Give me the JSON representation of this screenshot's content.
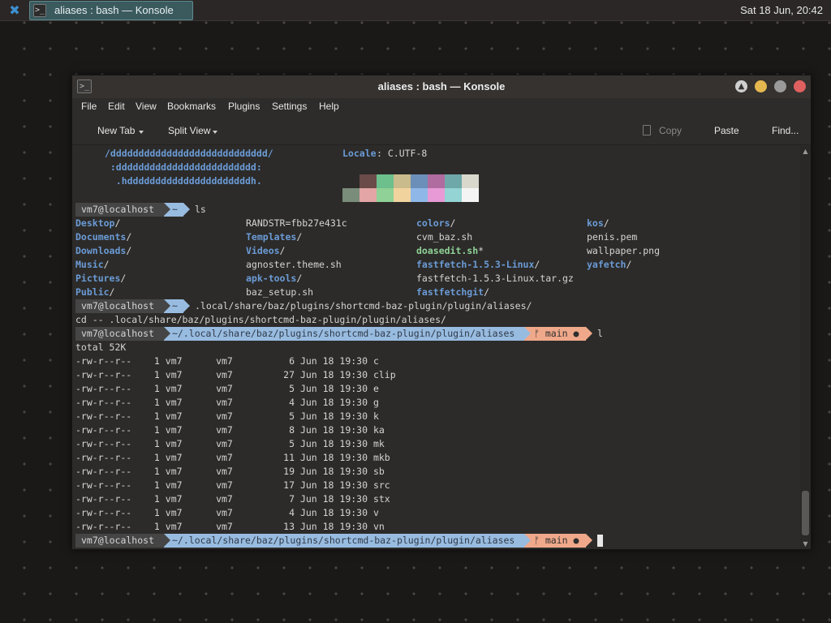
{
  "taskbar": {
    "launcher_icon": "kde-launcher-icon",
    "task_label": "aliases : bash — Konsole",
    "clock": "Sat 18 Jun, 20:42"
  },
  "window": {
    "title": "aliases : bash — Konsole",
    "buttons": [
      "keep-above",
      "minimize",
      "maximize",
      "close"
    ]
  },
  "menu": [
    "File",
    "Edit",
    "View",
    "Bookmarks",
    "Plugins",
    "Settings",
    "Help"
  ],
  "toolbar": {
    "new_tab": "New Tab",
    "split_view": "Split View",
    "copy": "Copy",
    "paste": "Paste",
    "find": "Find..."
  },
  "terminal": {
    "ascii": [
      "/dddddddddddddddddddddddddddd/",
      "  :ddddddddddddddddddddddddd:",
      "   .hddddddddddddddddddddddh."
    ],
    "locale_label": "Locale",
    "locale_value": ": C.UTF-8",
    "palette": {
      "row1": [
        "#2d2b29",
        "#6b4a4a",
        "#6dbf8c",
        "#c9bb8b",
        "#6b8fb8",
        "#b06b9f",
        "#6fa8a8",
        "#d8d8cc"
      ],
      "row2": [
        "#7a8c7a",
        "#e3a5a5",
        "#8fd196",
        "#f1d39e",
        "#8fb8e8",
        "#e79ad6",
        "#94d4d4",
        "#f4f4f4"
      ]
    },
    "prompt_user": "vm7@localhost",
    "prompt_home": "~",
    "prompt_path": "~/.local/share/baz/plugins/shortcmd-baz-plugin/plugin/aliases",
    "git_branch": "ᚠ main ●",
    "cmd_ls": "ls",
    "ls_rows": [
      [
        {
          "t": "Desktop",
          "c": "dir",
          "s": "/"
        },
        {
          "t": "RANDSTR=fbb27e431c",
          "c": "plain",
          "s": ""
        },
        {
          "t": "colors",
          "c": "dir",
          "s": "/"
        },
        {
          "t": "kos",
          "c": "dir",
          "s": "/"
        }
      ],
      [
        {
          "t": "Documents",
          "c": "dir",
          "s": "/"
        },
        {
          "t": "Templates",
          "c": "dir",
          "s": "/"
        },
        {
          "t": "cvm_baz.sh",
          "c": "plain",
          "s": ""
        },
        {
          "t": "penis.pem",
          "c": "plain",
          "s": ""
        }
      ],
      [
        {
          "t": "Downloads",
          "c": "dir",
          "s": "/"
        },
        {
          "t": "Videos",
          "c": "dir",
          "s": "/"
        },
        {
          "t": "doasedit.sh",
          "c": "exe",
          "s": "*"
        },
        {
          "t": "wallpaper.png",
          "c": "plain",
          "s": ""
        }
      ],
      [
        {
          "t": "Music",
          "c": "dir",
          "s": "/"
        },
        {
          "t": "agnoster.theme.sh",
          "c": "plain",
          "s": ""
        },
        {
          "t": "fastfetch-1.5.3-Linux",
          "c": "dir",
          "s": "/"
        },
        {
          "t": "yafetch",
          "c": "dir",
          "s": "/"
        }
      ],
      [
        {
          "t": "Pictures",
          "c": "dir",
          "s": "/"
        },
        {
          "t": "apk-tools",
          "c": "dir",
          "s": "/"
        },
        {
          "t": "fastfetch-1.5.3-Linux.tar.gz",
          "c": "plain",
          "s": ""
        },
        {
          "t": "",
          "c": "plain",
          "s": ""
        }
      ],
      [
        {
          "t": "Public",
          "c": "dir",
          "s": "/"
        },
        {
          "t": "baz_setup.sh",
          "c": "plain",
          "s": ""
        },
        {
          "t": "fastfetchgit",
          "c": "dir",
          "s": "/"
        },
        {
          "t": "",
          "c": "plain",
          "s": ""
        }
      ]
    ],
    "cmd_cd": ".local/share/baz/plugins/shortcmd-baz-plugin/plugin/aliases/",
    "cd_echo": "cd -- .local/share/baz/plugins/shortcmd-baz-plugin/plugin/aliases/",
    "cmd_l": "l",
    "total": "total 52K",
    "files": [
      {
        "perm": "-rw-r--r--",
        "links": "1",
        "user": "vm7",
        "group": "vm7",
        "size": "6",
        "date": "Jun 18 19:30",
        "name": "c"
      },
      {
        "perm": "-rw-r--r--",
        "links": "1",
        "user": "vm7",
        "group": "vm7",
        "size": "27",
        "date": "Jun 18 19:30",
        "name": "clip"
      },
      {
        "perm": "-rw-r--r--",
        "links": "1",
        "user": "vm7",
        "group": "vm7",
        "size": "5",
        "date": "Jun 18 19:30",
        "name": "e"
      },
      {
        "perm": "-rw-r--r--",
        "links": "1",
        "user": "vm7",
        "group": "vm7",
        "size": "4",
        "date": "Jun 18 19:30",
        "name": "g"
      },
      {
        "perm": "-rw-r--r--",
        "links": "1",
        "user": "vm7",
        "group": "vm7",
        "size": "5",
        "date": "Jun 18 19:30",
        "name": "k"
      },
      {
        "perm": "-rw-r--r--",
        "links": "1",
        "user": "vm7",
        "group": "vm7",
        "size": "8",
        "date": "Jun 18 19:30",
        "name": "ka"
      },
      {
        "perm": "-rw-r--r--",
        "links": "1",
        "user": "vm7",
        "group": "vm7",
        "size": "5",
        "date": "Jun 18 19:30",
        "name": "mk"
      },
      {
        "perm": "-rw-r--r--",
        "links": "1",
        "user": "vm7",
        "group": "vm7",
        "size": "11",
        "date": "Jun 18 19:30",
        "name": "mkb"
      },
      {
        "perm": "-rw-r--r--",
        "links": "1",
        "user": "vm7",
        "group": "vm7",
        "size": "19",
        "date": "Jun 18 19:30",
        "name": "sb"
      },
      {
        "perm": "-rw-r--r--",
        "links": "1",
        "user": "vm7",
        "group": "vm7",
        "size": "17",
        "date": "Jun 18 19:30",
        "name": "src"
      },
      {
        "perm": "-rw-r--r--",
        "links": "1",
        "user": "vm7",
        "group": "vm7",
        "size": "7",
        "date": "Jun 18 19:30",
        "name": "stx"
      },
      {
        "perm": "-rw-r--r--",
        "links": "1",
        "user": "vm7",
        "group": "vm7",
        "size": "4",
        "date": "Jun 18 19:30",
        "name": "v"
      },
      {
        "perm": "-rw-r--r--",
        "links": "1",
        "user": "vm7",
        "group": "vm7",
        "size": "13",
        "date": "Jun 18 19:30",
        "name": "vn"
      }
    ]
  },
  "colors": {
    "accent_blue": "#98bbe0",
    "git_orange": "#f0a88a",
    "dir_blue": "#6b9bd6",
    "exe_green": "#8fd196"
  }
}
